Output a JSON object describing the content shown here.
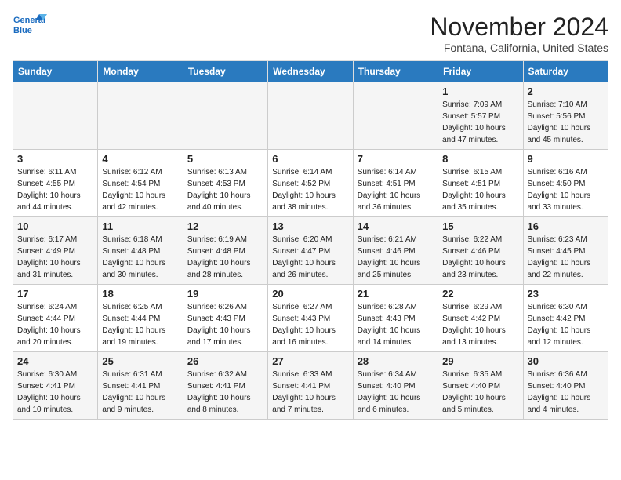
{
  "logo": {
    "line1": "General",
    "line2": "Blue"
  },
  "title": "November 2024",
  "location": "Fontana, California, United States",
  "days": [
    "Sunday",
    "Monday",
    "Tuesday",
    "Wednesday",
    "Thursday",
    "Friday",
    "Saturday"
  ],
  "weeks": [
    [
      {
        "date": "",
        "info": ""
      },
      {
        "date": "",
        "info": ""
      },
      {
        "date": "",
        "info": ""
      },
      {
        "date": "",
        "info": ""
      },
      {
        "date": "",
        "info": ""
      },
      {
        "date": "1",
        "info": "Sunrise: 7:09 AM\nSunset: 5:57 PM\nDaylight: 10 hours and 47 minutes."
      },
      {
        "date": "2",
        "info": "Sunrise: 7:10 AM\nSunset: 5:56 PM\nDaylight: 10 hours and 45 minutes."
      }
    ],
    [
      {
        "date": "3",
        "info": "Sunrise: 6:11 AM\nSunset: 4:55 PM\nDaylight: 10 hours and 44 minutes."
      },
      {
        "date": "4",
        "info": "Sunrise: 6:12 AM\nSunset: 4:54 PM\nDaylight: 10 hours and 42 minutes."
      },
      {
        "date": "5",
        "info": "Sunrise: 6:13 AM\nSunset: 4:53 PM\nDaylight: 10 hours and 40 minutes."
      },
      {
        "date": "6",
        "info": "Sunrise: 6:14 AM\nSunset: 4:52 PM\nDaylight: 10 hours and 38 minutes."
      },
      {
        "date": "7",
        "info": "Sunrise: 6:14 AM\nSunset: 4:51 PM\nDaylight: 10 hours and 36 minutes."
      },
      {
        "date": "8",
        "info": "Sunrise: 6:15 AM\nSunset: 4:51 PM\nDaylight: 10 hours and 35 minutes."
      },
      {
        "date": "9",
        "info": "Sunrise: 6:16 AM\nSunset: 4:50 PM\nDaylight: 10 hours and 33 minutes."
      }
    ],
    [
      {
        "date": "10",
        "info": "Sunrise: 6:17 AM\nSunset: 4:49 PM\nDaylight: 10 hours and 31 minutes."
      },
      {
        "date": "11",
        "info": "Sunrise: 6:18 AM\nSunset: 4:48 PM\nDaylight: 10 hours and 30 minutes."
      },
      {
        "date": "12",
        "info": "Sunrise: 6:19 AM\nSunset: 4:48 PM\nDaylight: 10 hours and 28 minutes."
      },
      {
        "date": "13",
        "info": "Sunrise: 6:20 AM\nSunset: 4:47 PM\nDaylight: 10 hours and 26 minutes."
      },
      {
        "date": "14",
        "info": "Sunrise: 6:21 AM\nSunset: 4:46 PM\nDaylight: 10 hours and 25 minutes."
      },
      {
        "date": "15",
        "info": "Sunrise: 6:22 AM\nSunset: 4:46 PM\nDaylight: 10 hours and 23 minutes."
      },
      {
        "date": "16",
        "info": "Sunrise: 6:23 AM\nSunset: 4:45 PM\nDaylight: 10 hours and 22 minutes."
      }
    ],
    [
      {
        "date": "17",
        "info": "Sunrise: 6:24 AM\nSunset: 4:44 PM\nDaylight: 10 hours and 20 minutes."
      },
      {
        "date": "18",
        "info": "Sunrise: 6:25 AM\nSunset: 4:44 PM\nDaylight: 10 hours and 19 minutes."
      },
      {
        "date": "19",
        "info": "Sunrise: 6:26 AM\nSunset: 4:43 PM\nDaylight: 10 hours and 17 minutes."
      },
      {
        "date": "20",
        "info": "Sunrise: 6:27 AM\nSunset: 4:43 PM\nDaylight: 10 hours and 16 minutes."
      },
      {
        "date": "21",
        "info": "Sunrise: 6:28 AM\nSunset: 4:43 PM\nDaylight: 10 hours and 14 minutes."
      },
      {
        "date": "22",
        "info": "Sunrise: 6:29 AM\nSunset: 4:42 PM\nDaylight: 10 hours and 13 minutes."
      },
      {
        "date": "23",
        "info": "Sunrise: 6:30 AM\nSunset: 4:42 PM\nDaylight: 10 hours and 12 minutes."
      }
    ],
    [
      {
        "date": "24",
        "info": "Sunrise: 6:30 AM\nSunset: 4:41 PM\nDaylight: 10 hours and 10 minutes."
      },
      {
        "date": "25",
        "info": "Sunrise: 6:31 AM\nSunset: 4:41 PM\nDaylight: 10 hours and 9 minutes."
      },
      {
        "date": "26",
        "info": "Sunrise: 6:32 AM\nSunset: 4:41 PM\nDaylight: 10 hours and 8 minutes."
      },
      {
        "date": "27",
        "info": "Sunrise: 6:33 AM\nSunset: 4:41 PM\nDaylight: 10 hours and 7 minutes."
      },
      {
        "date": "28",
        "info": "Sunrise: 6:34 AM\nSunset: 4:40 PM\nDaylight: 10 hours and 6 minutes."
      },
      {
        "date": "29",
        "info": "Sunrise: 6:35 AM\nSunset: 4:40 PM\nDaylight: 10 hours and 5 minutes."
      },
      {
        "date": "30",
        "info": "Sunrise: 6:36 AM\nSunset: 4:40 PM\nDaylight: 10 hours and 4 minutes."
      }
    ]
  ]
}
